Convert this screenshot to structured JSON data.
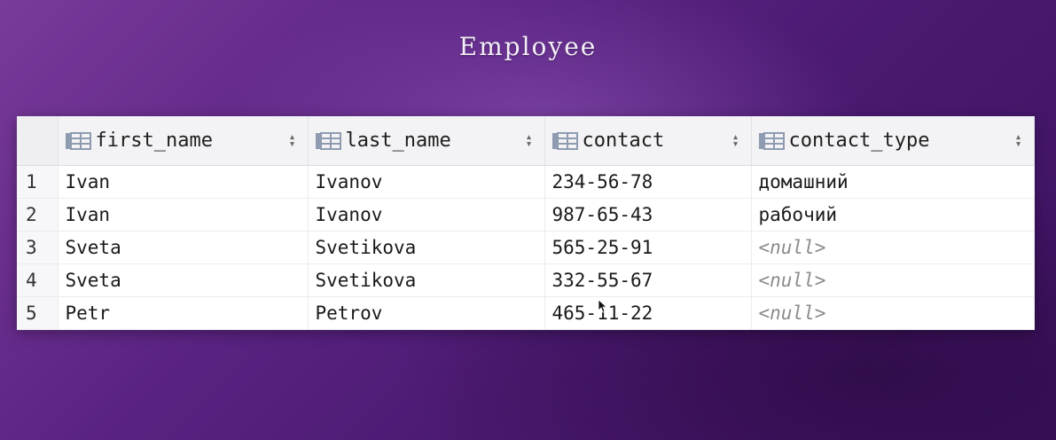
{
  "title": "Employee",
  "columns": [
    {
      "label": "first_name"
    },
    {
      "label": "last_name"
    },
    {
      "label": "contact"
    },
    {
      "label": "contact_type"
    }
  ],
  "rows": [
    {
      "index": "1",
      "first_name": "Ivan",
      "last_name": "Ivanov",
      "contact": "234-56-78",
      "contact_type": "домашний"
    },
    {
      "index": "2",
      "first_name": "Ivan",
      "last_name": "Ivanov",
      "contact": "987-65-43",
      "contact_type": "рабочий"
    },
    {
      "index": "3",
      "first_name": "Sveta",
      "last_name": "Svetikova",
      "contact": "565-25-91",
      "contact_type": "<null>"
    },
    {
      "index": "4",
      "first_name": "Sveta",
      "last_name": "Svetikova",
      "contact": "332-55-67",
      "contact_type": "<null>"
    },
    {
      "index": "5",
      "first_name": "Petr",
      "last_name": "Petrov",
      "contact": "465-11-22",
      "contact_type": "<null>"
    }
  ],
  "icons": {
    "column": "table-column-icon",
    "sort": "sort-arrows-icon"
  },
  "colors": {
    "background": "#5a2382",
    "table_header": "#f3f3f5",
    "null_text": "#8b8b8b"
  }
}
